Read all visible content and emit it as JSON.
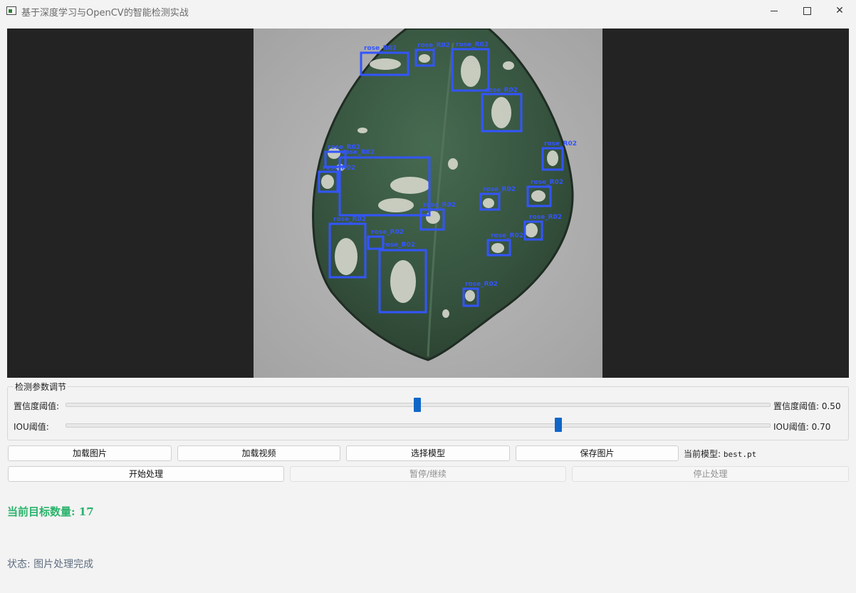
{
  "window": {
    "title": "基于深度学习与OpenCV的智能检测实战"
  },
  "detections": {
    "label": "rose_R02",
    "box_color": "#3355ff"
  },
  "params": {
    "group_title": "检测参数调节",
    "confidence_label": "置信度阈值:",
    "confidence_value_text": "置信度阈值: 0.50",
    "confidence": 0.5,
    "iou_label": "IOU阈值:",
    "iou_value_text": "IOU阈值: 0.70",
    "iou": 0.7
  },
  "buttons": {
    "load_image": "加载图片",
    "load_video": "加载视频",
    "select_model": "选择模型",
    "save_image": "保存图片",
    "start": "开始处理",
    "pause": "暂停/继续",
    "stop": "停止处理"
  },
  "model": {
    "prefix": "当前模型:",
    "name": "best.pt"
  },
  "count_text": "当前目标数量: 17",
  "status_text": "状态: 图片处理完成",
  "colors": {
    "accent": "#1066c7",
    "count": "#2ab36b",
    "status": "#5f6e80"
  }
}
